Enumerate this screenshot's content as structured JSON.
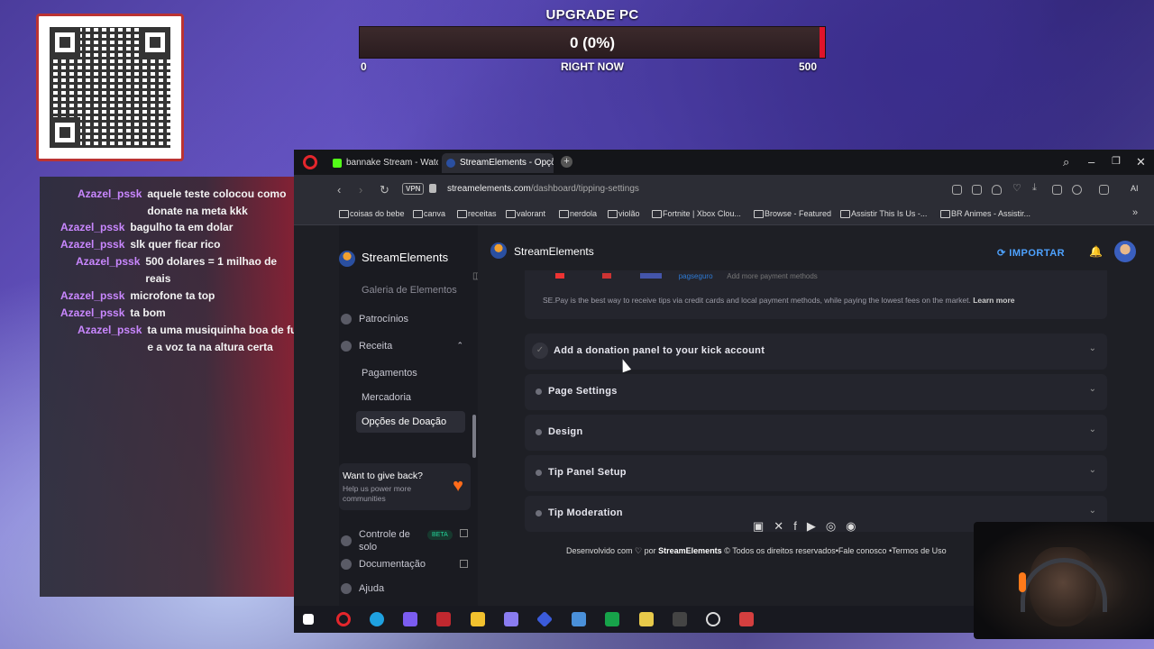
{
  "goal": {
    "title": "UPGRADE PC",
    "value_text": "0 (0%)",
    "progress": 0,
    "min": "0",
    "max": "500",
    "subtitle": "RIGHT NOW"
  },
  "chat": {
    "messages": [
      {
        "user": "Azazel_pssk",
        "text": "aquele teste colocou como donate na meta kkk"
      },
      {
        "user": "Azazel_pssk",
        "text": "bagulho ta em dolar"
      },
      {
        "user": "Azazel_pssk",
        "text": "slk quer ficar rico"
      },
      {
        "user": "Azazel_pssk",
        "text": "500 dolares = 1 milhao de reais"
      },
      {
        "user": "Azazel_pssk",
        "text": "microfone ta top"
      },
      {
        "user": "Azazel_pssk",
        "text": "ta bom"
      },
      {
        "user": "Azazel_pssk",
        "text": "ta uma musiquinha boa de fundo e a voz ta na altura certa"
      }
    ]
  },
  "browser": {
    "tabs": [
      {
        "label": "bannake Stream - Watch L",
        "icon": "kick-icon",
        "active": false
      },
      {
        "label": "StreamElements - Opções",
        "icon": "streamelements-icon",
        "active": true
      }
    ],
    "url_host": "streamelements.com",
    "url_path": "/dashboard/tipping-settings",
    "vpn_label": "VPN",
    "ai_label": "AI",
    "bookmarks": [
      "coisas do bebe",
      "canva",
      "receitas",
      "valorant",
      "nerdola",
      "violão",
      "Fortnite | Xbox Clou...",
      "Browse - Featured",
      "Assistir This Is Us -...",
      "BR Animes - Assistir..."
    ]
  },
  "sidebar": {
    "brand": "StreamElements",
    "items": {
      "galeria": "Galeria de Elementos",
      "patrocinios": "Patrocínios",
      "receita": "Receita",
      "pagamentos": "Pagamentos",
      "mercadoria": "Mercadoria",
      "opcoes": "Opções de Doação",
      "controle": "Controle de solo",
      "documentacao": "Documentação",
      "ajuda": "Ajuda"
    },
    "give_back": {
      "title": "Want to give back?",
      "subtitle": "Help us power more communities"
    },
    "beta_label": "BETA"
  },
  "main": {
    "brand": "StreamElements",
    "import_label": "IMPORTAR",
    "pay_more": "Add more payment methods",
    "pay_brand": "pagseguro",
    "pay_text": "SE.Pay is the best way to receive tips via credit cards and local payment methods, while paying the lowest fees on the market.",
    "pay_learn": "Learn more",
    "accordions": [
      "Add a donation panel to your kick account",
      "Page Settings",
      "Design",
      "Tip Panel Setup",
      "Tip Moderation"
    ],
    "footer": {
      "prefix": "Desenvolvido com",
      "by": "por",
      "brand": "StreamElements",
      "rights": "© Todos os direitos reservados",
      "contact": "•Fale conosco",
      "terms": "•Termos de Uso"
    }
  },
  "colors": {
    "accent": "#4ea2ff",
    "goal_red": "#e0142a",
    "chat_user": "#c987ff"
  }
}
